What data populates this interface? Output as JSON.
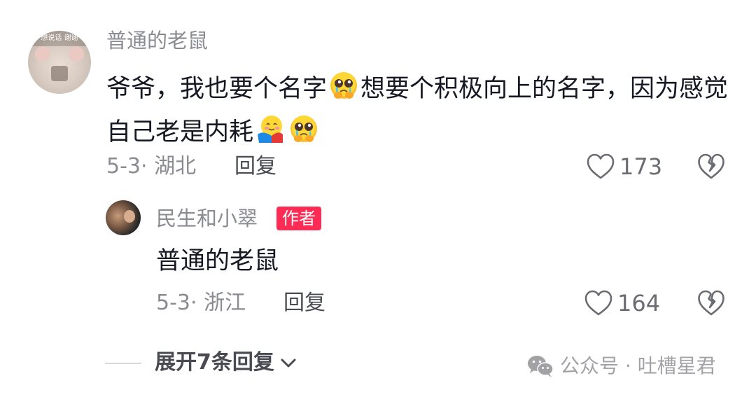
{
  "comment": {
    "avatar_strip_text": "想说话 谢谢",
    "username": "普通的老鼠",
    "text_part1": "爷爷，我也要个名字",
    "text_part2": "想要个积极向上的名字，因为感觉自己老是内耗",
    "emoji_1": "crying-pleading-emoji",
    "emoji_2": "hugging-emoji",
    "emoji_3": "crying-pleading-emoji",
    "date_location": "5-3· 湖北",
    "reply_label": "回复",
    "like_count": "173"
  },
  "reply": {
    "username": "民生和小翠",
    "badge": "作者",
    "text": "普通的老鼠",
    "date_location": "5-3· 浙江",
    "reply_label": "回复",
    "like_count": "164"
  },
  "expand": {
    "label": "展开7条回复"
  },
  "watermark": {
    "text": "公众号 · 吐槽星君"
  },
  "colors": {
    "accent_badge": "#fe2c55",
    "text_primary": "#161823",
    "text_secondary": "#8a8b91"
  }
}
